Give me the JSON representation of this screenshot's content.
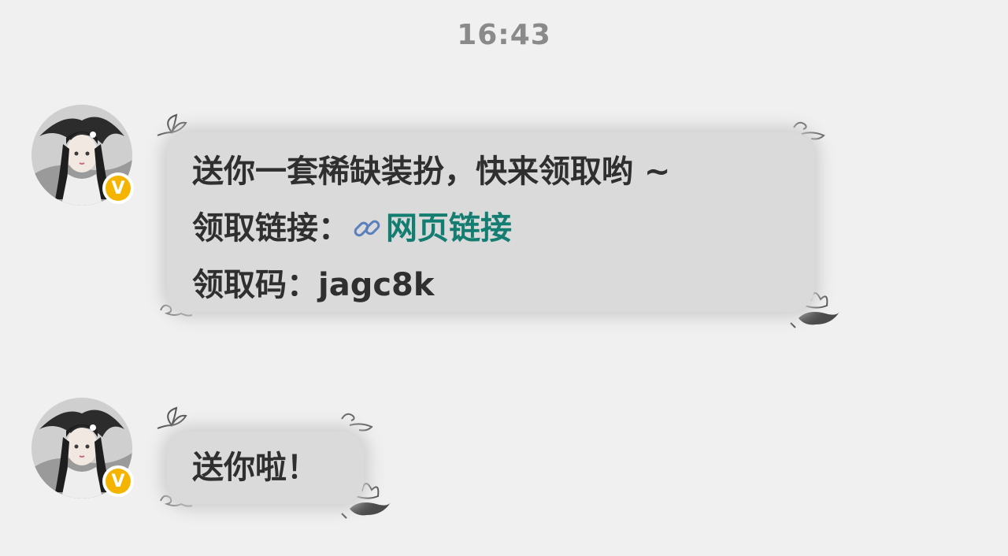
{
  "status": {
    "time": "16:43"
  },
  "messages": [
    {
      "sender_badge": "V",
      "lines": {
        "line1": "送你一套稀缺装扮，快来领取哟 ~",
        "line2_label": "领取链接：",
        "line2_link": "网页链接",
        "line3": "领取码：jagc8k"
      }
    },
    {
      "sender_badge": "V",
      "text": "送你啦！"
    }
  ],
  "icons": {
    "link": "link-icon",
    "verified": "verified-badge-icon",
    "butterfly": "butterfly-icon",
    "cloud": "cloud-swirl-icon",
    "lotus": "lotus-icon"
  },
  "colors": {
    "background": "#f0f0f0",
    "bubble": "#dadada",
    "text": "#2f2f2f",
    "link": "#147d72",
    "link_icon": "#5a7fbf",
    "badge": "#f5b400",
    "timestamp": "#8a8a8a"
  }
}
